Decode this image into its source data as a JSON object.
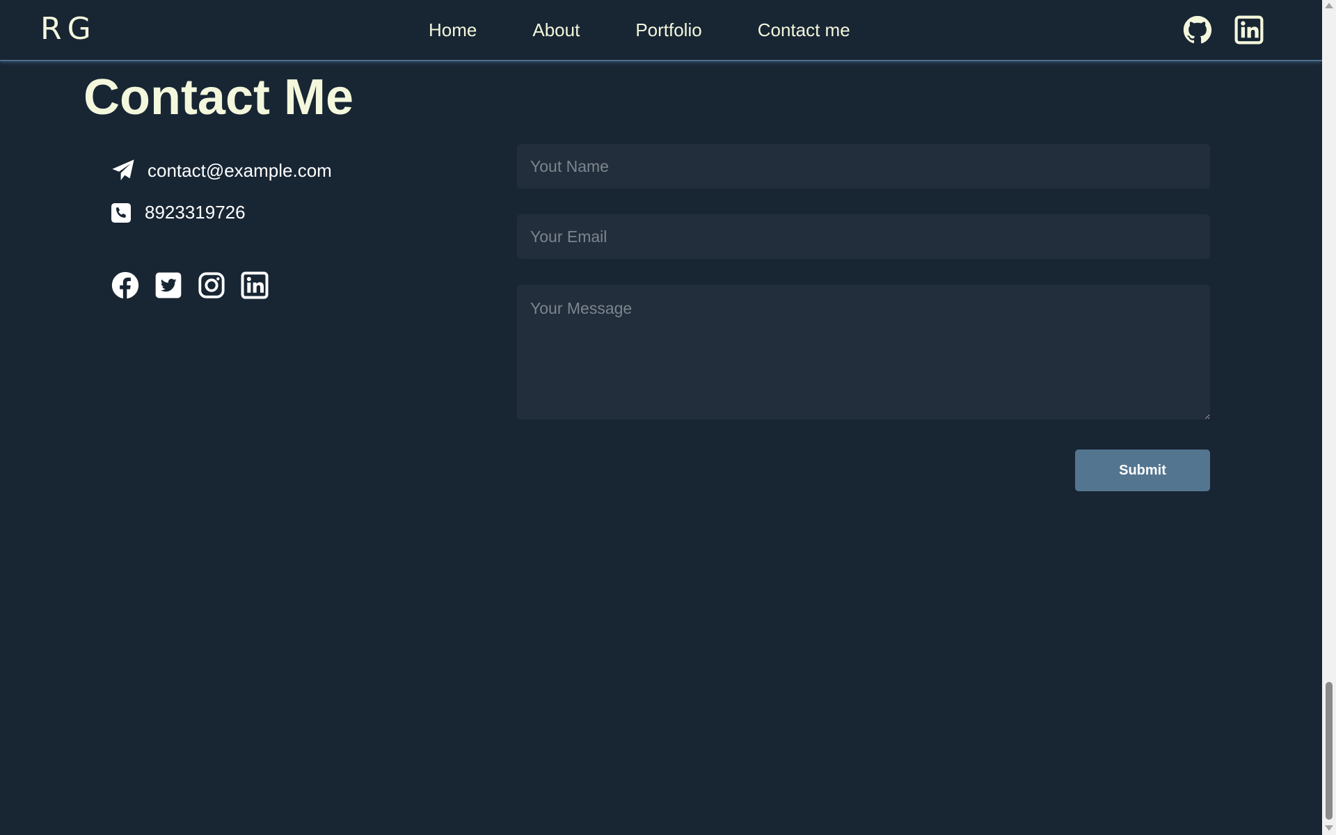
{
  "navbar": {
    "logo": "RG",
    "links": [
      {
        "label": "Home"
      },
      {
        "label": "About"
      },
      {
        "label": "Portfolio"
      },
      {
        "label": "Contact me"
      }
    ],
    "icons": [
      "github-icon",
      "linkedin-icon"
    ]
  },
  "contact": {
    "title": "Contact Me",
    "email": "contact@example.com",
    "phone": "8923319726",
    "socials": [
      "facebook-icon",
      "twitter-icon",
      "instagram-icon",
      "linkedin-icon"
    ]
  },
  "form": {
    "name_placeholder": "Yout Name",
    "email_placeholder": "Your Email",
    "message_placeholder": "Your Message",
    "submit_label": "Submit"
  },
  "colors": {
    "background": "#182533",
    "accent_text": "#f3f7dc",
    "field_bg": "#222e3b",
    "button_bg": "#537590",
    "navbar_border": "#4d6f8e"
  }
}
